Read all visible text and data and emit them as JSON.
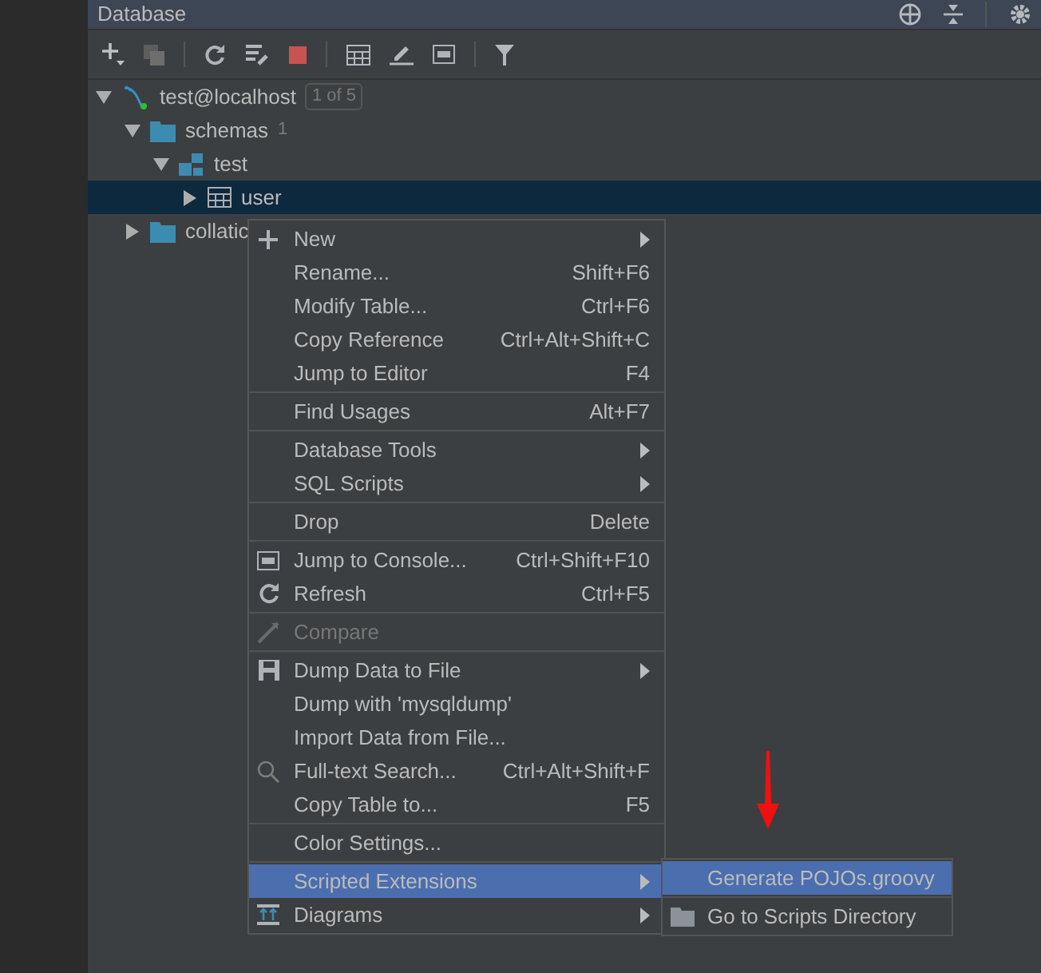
{
  "panel": {
    "title": "Database"
  },
  "tree": [
    {
      "label": "test@localhost",
      "badge": "1 of 5",
      "kind": "datasource",
      "expanded": true,
      "selected": false,
      "children": [
        {
          "label": "schemas",
          "count": "1",
          "kind": "folder",
          "expanded": true,
          "selected": false,
          "children": [
            {
              "label": "test",
              "kind": "schema",
              "expanded": true,
              "selected": false,
              "children": [
                {
                  "label": "user",
                  "kind": "table",
                  "expanded": false,
                  "selected": true
                }
              ]
            }
          ]
        },
        {
          "label": "collatic",
          "kind": "folder",
          "expanded": false,
          "selected": false
        }
      ]
    }
  ],
  "context_menu": [
    {
      "kind": "item",
      "label": "New",
      "submenu": true,
      "disabled": false,
      "selected": false
    },
    {
      "kind": "item",
      "label": "Rename...",
      "shortcut": "Shift+F6",
      "disabled": false,
      "selected": false
    },
    {
      "kind": "item",
      "label": "Modify Table...",
      "shortcut": "Ctrl+F6",
      "disabled": false,
      "selected": false
    },
    {
      "kind": "item",
      "label": "Copy Reference",
      "shortcut": "Ctrl+Alt+Shift+C",
      "disabled": false,
      "selected": false
    },
    {
      "kind": "item",
      "label": "Jump to Editor",
      "shortcut": "F4",
      "disabled": false,
      "selected": false
    },
    {
      "kind": "separator"
    },
    {
      "kind": "item",
      "label": "Find Usages",
      "shortcut": "Alt+F7",
      "disabled": false,
      "selected": false
    },
    {
      "kind": "separator"
    },
    {
      "kind": "item",
      "label": "Database Tools",
      "submenu": true,
      "disabled": false,
      "selected": false
    },
    {
      "kind": "item",
      "label": "SQL Scripts",
      "submenu": true,
      "disabled": false,
      "selected": false
    },
    {
      "kind": "separator"
    },
    {
      "kind": "item",
      "label": "Drop",
      "shortcut": "Delete",
      "disabled": false,
      "selected": false
    },
    {
      "kind": "separator"
    },
    {
      "kind": "item",
      "label": "Jump to Console...",
      "shortcut": "Ctrl+Shift+F10",
      "disabled": false,
      "selected": false
    },
    {
      "kind": "item",
      "label": "Refresh",
      "shortcut": "Ctrl+F5",
      "disabled": false,
      "selected": false
    },
    {
      "kind": "separator"
    },
    {
      "kind": "item",
      "label": "Compare",
      "disabled": true,
      "selected": false
    },
    {
      "kind": "separator"
    },
    {
      "kind": "item",
      "label": "Dump Data to File",
      "submenu": true,
      "disabled": false,
      "selected": false
    },
    {
      "kind": "item",
      "label": "Dump with 'mysqldump'",
      "disabled": false,
      "selected": false
    },
    {
      "kind": "item",
      "label": "Import Data from File...",
      "disabled": false,
      "selected": false
    },
    {
      "kind": "item",
      "label": "Full-text Search...",
      "shortcut": "Ctrl+Alt+Shift+F",
      "disabled": false,
      "selected": false
    },
    {
      "kind": "item",
      "label": "Copy Table to...",
      "shortcut": "F5",
      "disabled": false,
      "selected": false
    },
    {
      "kind": "separator"
    },
    {
      "kind": "item",
      "label": "Color Settings...",
      "disabled": false,
      "selected": false
    },
    {
      "kind": "separator"
    },
    {
      "kind": "item",
      "label": "Scripted Extensions",
      "submenu": true,
      "disabled": false,
      "selected": true
    },
    {
      "kind": "item",
      "label": "Diagrams",
      "submenu": true,
      "disabled": false,
      "selected": false
    }
  ],
  "submenu": [
    {
      "kind": "item",
      "label": "Generate POJOs.groovy",
      "selected": true
    },
    {
      "kind": "separator"
    },
    {
      "kind": "item",
      "label": "Go to Scripts Directory",
      "selected": false
    }
  ]
}
